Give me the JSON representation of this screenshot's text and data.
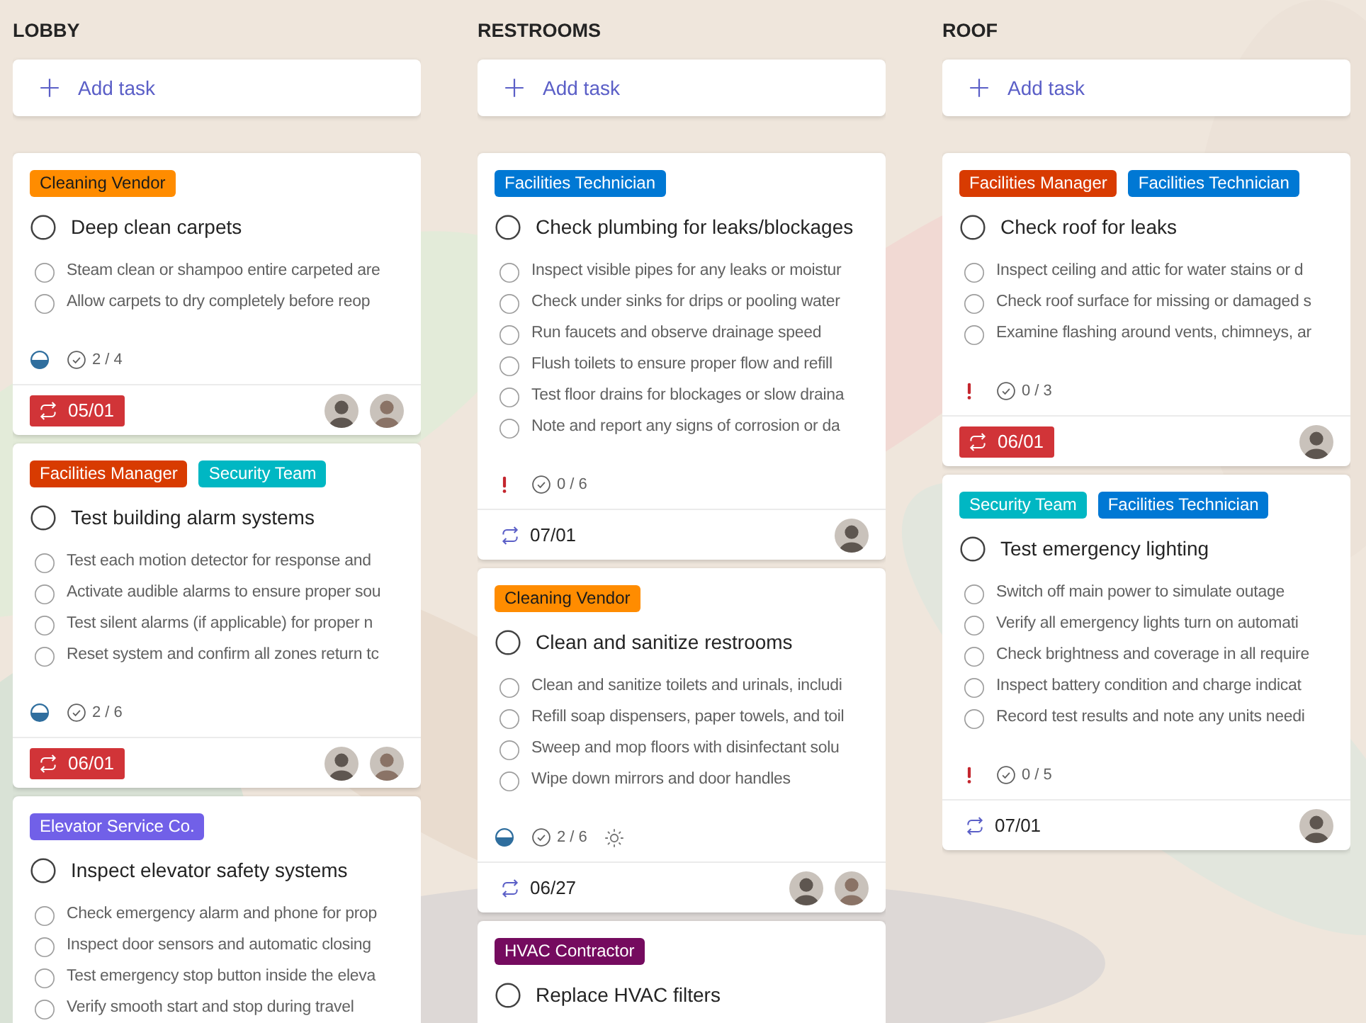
{
  "columns": [
    {
      "title": "LOBBY",
      "add_task": "Add task",
      "cards": [
        {
          "labels": [
            {
              "text": "Cleaning Vendor",
              "color": "#ff8c00"
            }
          ],
          "title": "Deep clean carpets",
          "checked": false,
          "subtasks": [
            {
              "text": "Steam clean or shampoo entire carpeted are",
              "checked": false
            },
            {
              "text": "Allow carpets to dry completely before reop",
              "checked": false
            }
          ],
          "in_progress": true,
          "urgent": false,
          "checklist": "2 / 4",
          "extra_icon": false,
          "due": "05/01",
          "overdue": true,
          "avatars": [
            {
              "kind": "picture"
            },
            {
              "kind": "picture"
            }
          ]
        },
        {
          "labels": [
            {
              "text": "Facilities Manager",
              "color": "#d83b01"
            },
            {
              "text": "Security Team",
              "color": "#00b7c3"
            }
          ],
          "title": "Test building alarm systems",
          "checked": false,
          "subtasks": [
            {
              "text": "Test each motion detector for response and",
              "checked": false
            },
            {
              "text": "Activate audible alarms to ensure proper sou",
              "checked": false
            },
            {
              "text": "Test silent alarms (if applicable) for proper n",
              "checked": false
            },
            {
              "text": "Reset system and confirm all zones return tc",
              "checked": false
            }
          ],
          "in_progress": true,
          "urgent": false,
          "checklist": "2 / 6",
          "extra_icon": false,
          "due": "06/01",
          "overdue": true,
          "avatars": [
            {
              "kind": "picture"
            },
            {
              "kind": "picture"
            }
          ]
        },
        {
          "labels": [
            {
              "text": "Elevator Service Co.",
              "color": "#7160e8"
            }
          ],
          "title": "Inspect elevator safety systems",
          "checked": false,
          "subtasks": [
            {
              "text": "Check emergency alarm and phone for prop",
              "checked": false
            },
            {
              "text": "Inspect door sensors and automatic closing",
              "checked": false
            },
            {
              "text": "Test emergency stop button inside the eleva",
              "checked": false
            },
            {
              "text": "Verify smooth start and stop during travel",
              "checked": false
            }
          ]
        }
      ]
    },
    {
      "title": "RESTROOMS",
      "add_task": "Add task",
      "cards": [
        {
          "labels": [
            {
              "text": "Facilities Technician",
              "color": "#0078d4"
            }
          ],
          "title": "Check plumbing for leaks/blockages",
          "checked": false,
          "subtasks": [
            {
              "text": "Inspect visible pipes for any leaks or moistur",
              "checked": false
            },
            {
              "text": "Check under sinks for drips or pooling water",
              "checked": false
            },
            {
              "text": "Run faucets and observe drainage speed",
              "checked": false
            },
            {
              "text": "Flush toilets to ensure proper flow and refill",
              "checked": false
            },
            {
              "text": "Test floor drains for blockages or slow draina",
              "checked": false
            },
            {
              "text": "Note and report any signs of corrosion or da",
              "checked": false
            }
          ],
          "in_progress": false,
          "urgent": true,
          "checklist": "0 / 6",
          "extra_icon": false,
          "due": "07/01",
          "overdue": false,
          "avatars": [
            {
              "kind": "picture"
            }
          ]
        },
        {
          "labels": [
            {
              "text": "Cleaning Vendor",
              "color": "#ff8c00"
            }
          ],
          "title": "Clean and sanitize restrooms",
          "checked": false,
          "subtasks": [
            {
              "text": "Clean and sanitize toilets and urinals, includi",
              "checked": false
            },
            {
              "text": "Refill soap dispensers, paper towels, and toil",
              "checked": false
            },
            {
              "text": "Sweep and mop floors with disinfectant solu",
              "checked": false
            },
            {
              "text": "Wipe down mirrors and door handles",
              "checked": false
            }
          ],
          "in_progress": true,
          "urgent": false,
          "checklist": "2 / 6",
          "extra_icon": true,
          "due": "06/27",
          "overdue": false,
          "avatars": [
            {
              "kind": "picture"
            },
            {
              "kind": "picture"
            }
          ]
        },
        {
          "labels": [
            {
              "text": "HVAC Contractor",
              "color": "#750b5f"
            }
          ],
          "title": "Replace HVAC filters",
          "checked": false
        }
      ]
    },
    {
      "title": "ROOF",
      "add_task": "Add task",
      "cards": [
        {
          "labels": [
            {
              "text": "Facilities Manager",
              "color": "#d83b01"
            },
            {
              "text": "Facilities Technician",
              "color": "#0078d4"
            }
          ],
          "title": "Check roof for leaks",
          "checked": false,
          "subtasks": [
            {
              "text": "Inspect ceiling and attic for water stains or d",
              "checked": false
            },
            {
              "text": "Check roof surface for missing or damaged s",
              "checked": false
            },
            {
              "text": "Examine flashing around vents, chimneys, ar",
              "checked": false
            }
          ],
          "in_progress": false,
          "urgent": true,
          "checklist": "0 / 3",
          "extra_icon": false,
          "due": "06/01",
          "overdue": true,
          "avatars": [
            {
              "kind": "picture"
            }
          ]
        },
        {
          "labels": [
            {
              "text": "Security Team",
              "color": "#00b7c3"
            },
            {
              "text": "Facilities Technician",
              "color": "#0078d4"
            }
          ],
          "title": "Test emergency lighting",
          "checked": false,
          "subtasks": [
            {
              "text": "Switch off main power to simulate outage",
              "checked": false
            },
            {
              "text": "Verify all emergency lights turn on automati",
              "checked": false
            },
            {
              "text": "Check brightness and coverage in all require",
              "checked": false
            },
            {
              "text": "Inspect battery condition and charge indicat",
              "checked": false
            },
            {
              "text": "Record test results and note any units needi",
              "checked": false
            }
          ],
          "in_progress": false,
          "urgent": true,
          "checklist": "0 / 5",
          "extra_icon": false,
          "due": "07/01",
          "overdue": false,
          "avatars": [
            {
              "kind": "picture"
            }
          ]
        }
      ]
    }
  ]
}
